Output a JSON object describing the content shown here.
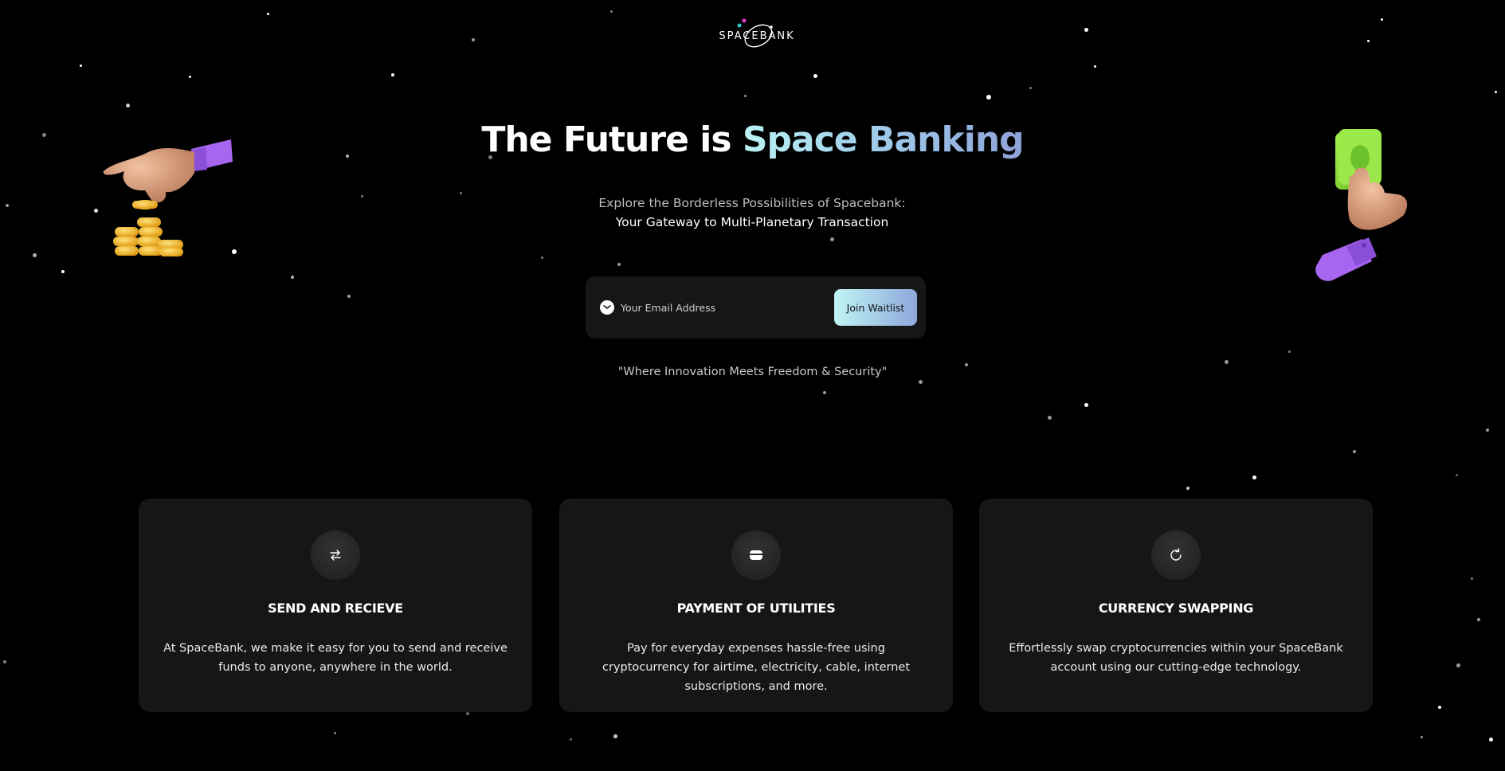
{
  "brand": {
    "logo_text": "SPACEBANK"
  },
  "hero": {
    "title_plain": "The Future is ",
    "title_accent": "Space Banking",
    "subtitle_plain": "Explore the Borderless Possibilities of Spacebank: ",
    "subtitle_strong": "Your Gateway to Multi-Planetary Transaction"
  },
  "waitlist": {
    "email_placeholder": "Your Email Address",
    "email_value": "",
    "button_label": "Join Waitlist"
  },
  "tagline": "\"Where Innovation Meets Freedom & Security\"",
  "features": [
    {
      "icon": "swap-arrows-icon",
      "title": "SEND AND RECIEVE",
      "description": "At SpaceBank, we make it easy for you to send and receive funds to anyone, anywhere in the world."
    },
    {
      "icon": "wallet-icon",
      "title": "PAYMENT OF UTILITIES",
      "description": "Pay for everyday expenses hassle-free using cryptocurrency for airtime, electricity, cable, internet subscriptions, and more."
    },
    {
      "icon": "refresh-icon",
      "title": "CURRENCY SWAPPING",
      "description": "Effortlessly swap cryptocurrencies within your SpaceBank account using our cutting-edge technology."
    }
  ],
  "colors": {
    "background": "#000000",
    "card": "#161616",
    "accent_gradient_start": "#b9f1f4",
    "accent_gradient_end": "#8ea2d8",
    "sleeve_purple": "#9b5de5",
    "cash_green": "#8ee03a",
    "coin_gold": "#f2b01e"
  },
  "decorations": {
    "left_illustration": "hand-dropping-coins",
    "right_illustration": "hand-holding-cash"
  }
}
